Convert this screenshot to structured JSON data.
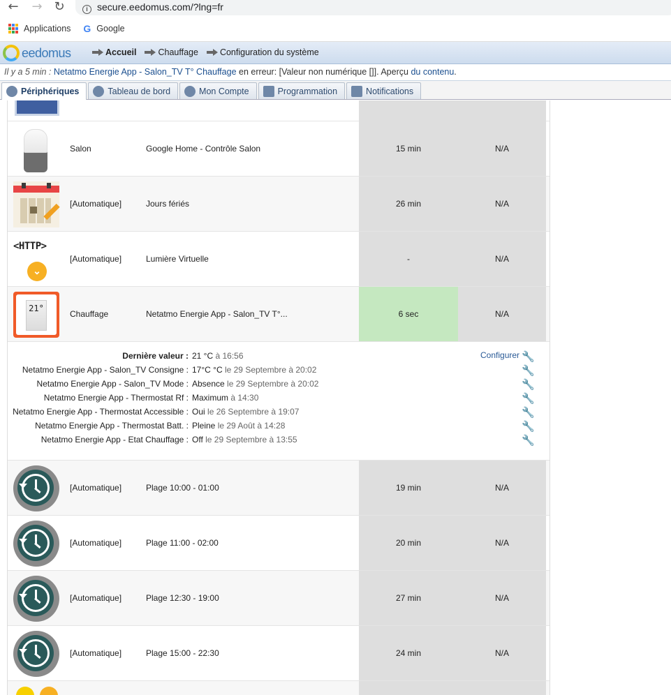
{
  "browser": {
    "url": "secure.eedomus.com/?lng=fr",
    "bookmarks": [
      "Applications",
      "Google"
    ]
  },
  "header": {
    "logo_text": "eedomus",
    "crumbs": [
      "Accueil",
      "Chauffage",
      "Configuration du système"
    ]
  },
  "error": {
    "time": "Il y a 5 min :",
    "device": "Netatmo Energie App - Salon_TV T° Chauffage",
    "middle": " en erreur: [Valeur non numérique []]. Aperçu ",
    "link": "du contenu",
    "end": "."
  },
  "tabs": [
    {
      "label": "Périphériques",
      "icon": "devices-icon"
    },
    {
      "label": "Tableau de bord",
      "icon": "dashboard-icon"
    },
    {
      "label": "Mon Compte",
      "icon": "user-icon"
    },
    {
      "label": "Programmation",
      "icon": "wand-icon"
    },
    {
      "label": "Notifications",
      "icon": "mail-icon"
    }
  ],
  "rows": [
    {
      "room": "Salon",
      "name": "Google Home - Contrôle Salon",
      "time": "15 min",
      "value": "N/A",
      "icon": "google-home-icon"
    },
    {
      "room": "[Automatique]",
      "name": "Jours fériés",
      "time": "26 min",
      "value": "N/A",
      "icon": "calendar-icon"
    },
    {
      "room": "[Automatique]",
      "name": "Lumière Virtuelle",
      "time": "-",
      "value": "N/A",
      "icon": "http-icon",
      "icon_text": "<HTTP>"
    },
    {
      "room": "Chauffage",
      "name": "Netatmo Energie App - Salon_TV T°...",
      "time": "6 sec",
      "value": "N/A",
      "icon": "thermostat-icon",
      "icon_text": "21°"
    }
  ],
  "details": {
    "configure_label": "Configurer",
    "lines": [
      {
        "key": "Dernière valeur :",
        "value": "21 °C",
        "date": " à 16:56"
      },
      {
        "key": "Netatmo Energie App - Salon_TV Consigne :",
        "value": "17°C °C",
        "date": " le 29 Septembre à 20:02"
      },
      {
        "key": "Netatmo Energie App - Salon_TV Mode :",
        "value": "Absence",
        "date": " le 29 Septembre à 20:02"
      },
      {
        "key": "Netatmo Energie App - Thermostat Rf :",
        "value": "Maximum",
        "date": " à 14:30"
      },
      {
        "key": "Netatmo Energie App - Thermostat Accessible :",
        "value": "Oui",
        "date": " le 26 Septembre à 19:07"
      },
      {
        "key": "Netatmo Energie App - Thermostat Batt. :",
        "value": "Pleine",
        "date": " le 29 Août à 14:28"
      },
      {
        "key": "Netatmo Energie App - Etat Chauffage :",
        "value": "Off",
        "date": " le 29 Septembre à 13:55"
      }
    ]
  },
  "rows2": [
    {
      "room": "[Automatique]",
      "name": "Plage 10:00 - 01:00",
      "time": "19 min",
      "value": "N/A",
      "icon": "clock-icon"
    },
    {
      "room": "[Automatique]",
      "name": "Plage 11:00 - 02:00",
      "time": "20 min",
      "value": "N/A",
      "icon": "clock-icon"
    },
    {
      "room": "[Automatique]",
      "name": "Plage 12:30 - 19:00",
      "time": "27 min",
      "value": "N/A",
      "icon": "clock-icon"
    },
    {
      "room": "[Automatique]",
      "name": "Plage 15:00 - 22:30",
      "time": "24 min",
      "value": "N/A",
      "icon": "clock-icon"
    }
  ]
}
